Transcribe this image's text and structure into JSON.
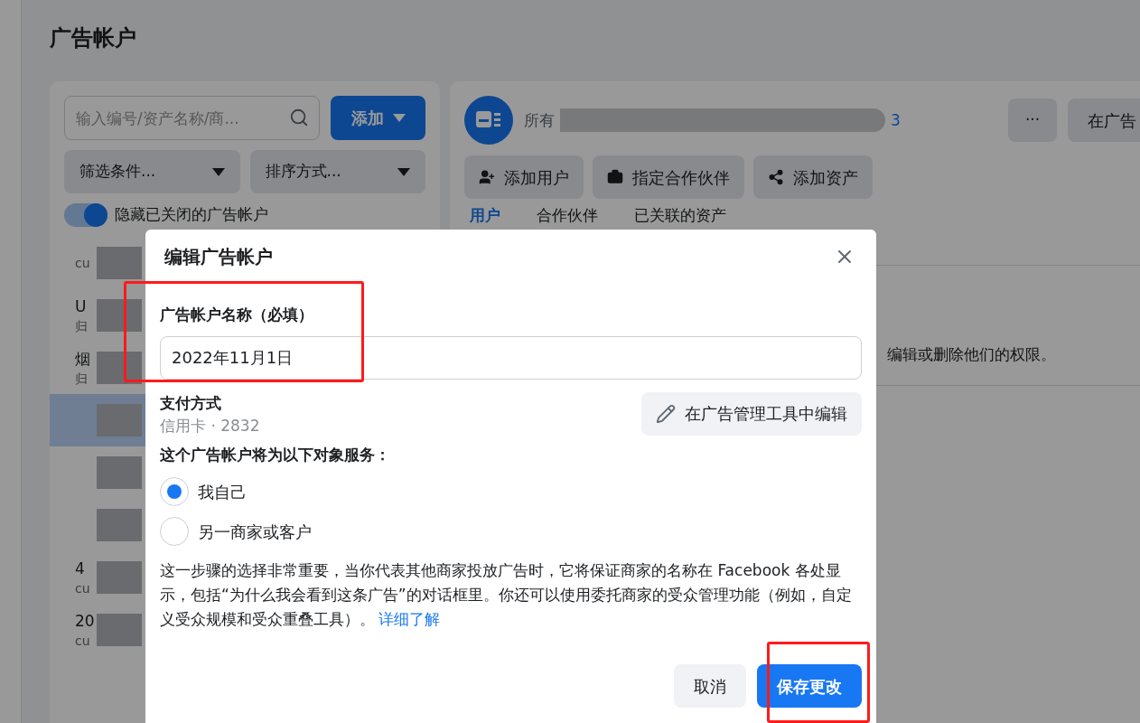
{
  "page_title": "广告帐户",
  "left_panel": {
    "search": {
      "placeholder": "输入编号/资产名称/商..."
    },
    "add_button": "添加",
    "filters": [
      "筛选条件...",
      "排序方式..."
    ],
    "toggle": {
      "label": "隐藏已关闭的广告帐户",
      "on": true
    },
    "accounts": [
      {
        "detail": "cu",
        "selected": false
      },
      {
        "name": "U",
        "detail": "归",
        "selected": false
      },
      {
        "name": "烟",
        "detail": "归",
        "selected": false
      },
      {
        "selected": true
      },
      {
        "selected": false
      },
      {
        "selected": false
      },
      {
        "name": "4",
        "detail": "cu",
        "selected": false
      },
      {
        "name": "20",
        "detail": "cu",
        "selected": false
      }
    ]
  },
  "right_panel": {
    "owner_label": "所有",
    "count": "3",
    "more_button": "···",
    "open_button": "在广告",
    "actions": [
      "添加用户",
      "指定合作伙伴",
      "添加资产"
    ],
    "tabs": [
      {
        "label": "用户",
        "selected": true
      },
      {
        "label": "合作伙伴",
        "selected": false
      },
      {
        "label": "已关联的资产",
        "selected": false
      }
    ],
    "permission_text": "编辑或删除他们的权限。"
  },
  "dialog": {
    "title": "编辑广告帐户",
    "name_field": {
      "label": "广告帐户名称（必填）",
      "value": "2022年11月1日"
    },
    "payment": {
      "label": "支付方式",
      "value": "信用卡 · 2832",
      "edit_button": "在广告管理工具中编辑"
    },
    "audience": {
      "label": "这个广告帐户将为以下对象服务：",
      "options": [
        {
          "label": "我自己",
          "selected": true
        },
        {
          "label": "另一商家或客户",
          "selected": false
        }
      ]
    },
    "note": "这一步骤的选择非常重要，当你代表其他商家投放广告时，它将保证商家的名称在 Facebook 各处显示，包括“为什么我会看到这条广告”的对话框里。你还可以使用委托商家的受众管理功能（例如，自定义受众规模和受众重叠工具）。",
    "note_link": "详细了解",
    "buttons": {
      "cancel": "取消",
      "save": "保存更改"
    }
  }
}
